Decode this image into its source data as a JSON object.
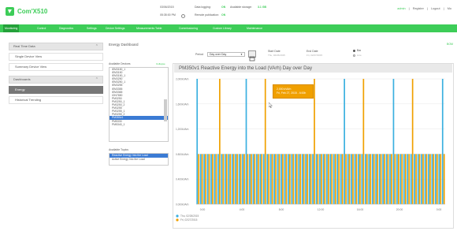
{
  "header": {
    "app_name": "Com'X510",
    "date": "03/06/2015",
    "time": "05:35:00 PM",
    "data_logging_label": "Data logging:",
    "data_logging_value": "ON",
    "available_storage_label": "Available storage:",
    "available_storage_value": "3.1 GB",
    "remote_publication_label": "Remote publication:",
    "remote_publication_value": "ON",
    "user": "admin",
    "register": "Register",
    "logout": "Logout",
    "more": "Mo"
  },
  "nav": {
    "items": [
      "Monitoring",
      "Control",
      "Diagnostics",
      "Settings",
      "Device Settings",
      "Measurements Table",
      "Commissioning",
      "Custom Library",
      "Maintenance"
    ],
    "active": "Monitoring"
  },
  "sidebar": {
    "real_time_header": "Real Time Data",
    "single_device": "Single Device View",
    "summary_device": "Summary Device View",
    "dashboards_header": "Dashboards",
    "energy": "Energy",
    "historical": "Historical Trending"
  },
  "main": {
    "title": "Energy Dashboard",
    "top_link": "BOM",
    "period_label": "Period",
    "period_value": "Day over Day",
    "start_date_label": "Start Date",
    "start_date_value": "Thu, 02/26/2015",
    "end_date_label": "End Date",
    "end_date_value": "Fri, 02/27/2015",
    "bar_option": "Bar",
    "line_option": "Line",
    "available_devices_label": "Available Devices",
    "available_devices_link": "Collapse",
    "devices": [
      "iEM3150_1",
      "iEM3150",
      "iEM3150_1",
      "iEM3250",
      "iEM3250_1",
      "iEM3255",
      "iEM3355",
      "iEM3365",
      "iON7650",
      "PM3250",
      "PM3250_1",
      "PM3250_2",
      "PM3255",
      "PM3255_1",
      "PM3255_2",
      "PM350v1",
      "PM5330",
      "PM5340_1"
    ],
    "selected_device": "PM350v1",
    "available_topics_label": "Available Topics",
    "topics": [
      "Reactive Energy Into the Load",
      "Active Energy Into the Load"
    ],
    "selected_topic": "Reactive Energy Into the Load"
  },
  "tooltip": {
    "line1": "2,000 kVArh",
    "line2": "Fri, Feb 27, 2015 - 6:00h"
  },
  "chart_data": {
    "type": "bar",
    "title": "PM350v1 Reactive Energy into the Load (VArh) Day over Day",
    "y_ticks": [
      "2,000kVArh",
      "1,600kVArh",
      "1,200kVArh",
      "0.800kVArh",
      "0.400kVArh",
      "0.000kVArh"
    ],
    "x_ticks": [
      "0:00",
      "4:00",
      "8:00",
      "12:00",
      "16:00",
      "20:00",
      "0:00"
    ],
    "ylim": [
      0,
      2.0
    ],
    "series": [
      {
        "name": "Thu, 02/26/2015",
        "color": "#3ab0e0",
        "values": [
          2.0,
          0.8,
          0.8,
          0.8,
          0.8,
          0.8,
          0.8,
          0.8,
          0.8,
          0.8,
          0.8,
          0.8,
          0.8,
          0.8,
          2.0,
          0.8,
          0.8,
          0.8,
          0.8,
          0.8,
          0.8,
          0.8,
          0.8,
          0.8,
          0.8,
          0.8,
          0.8,
          0.8,
          0.8,
          0.8,
          0.8,
          0.8,
          0.8,
          0.8,
          0.8,
          0.8,
          0.8,
          0.8,
          0.8,
          0.8,
          0.8,
          0.8,
          2.0,
          0.8,
          0.8,
          0.8,
          0.8,
          0.8,
          0.8,
          0.8,
          0.8,
          0.8,
          0.8,
          0.8,
          0.8,
          0.8,
          2.0,
          0.8,
          0.8,
          0.8,
          0.8,
          0.8,
          0.8,
          0.8,
          0.8,
          0.8,
          0.8,
          0.8,
          0.8,
          0.8,
          2.0
        ]
      },
      {
        "name": "Fri, 02/27/2015",
        "color": "#f0a000",
        "values": [
          0.8,
          0.8,
          0.8,
          0.8,
          0.8,
          0.8,
          2.0,
          0.8,
          0.8,
          0.8,
          0.8,
          0.8,
          0.8,
          0.8,
          0.8,
          0.8,
          0.8,
          0.8,
          0.8,
          2.0,
          0.8,
          0.8,
          0.8,
          0.8,
          0.8,
          0.8,
          0.8,
          0.8,
          0.8,
          0.8,
          0.8,
          0.8,
          0.8,
          2.0,
          0.8,
          0.8,
          0.8,
          0.8,
          0.8,
          0.8,
          0.8,
          0.8,
          0.8,
          0.8,
          0.8,
          0.8,
          0.8,
          2.0,
          0.8,
          0.8,
          0.8,
          0.8,
          0.8,
          0.8,
          0.8,
          0.8,
          0.8,
          0.8,
          0.8,
          0.8,
          0.8,
          2.0,
          0.8,
          0.8,
          0.8,
          0.8,
          0.8,
          0.8,
          0.8,
          0.8,
          0.8
        ]
      }
    ],
    "legend": "bottom-left",
    "grid": true
  }
}
